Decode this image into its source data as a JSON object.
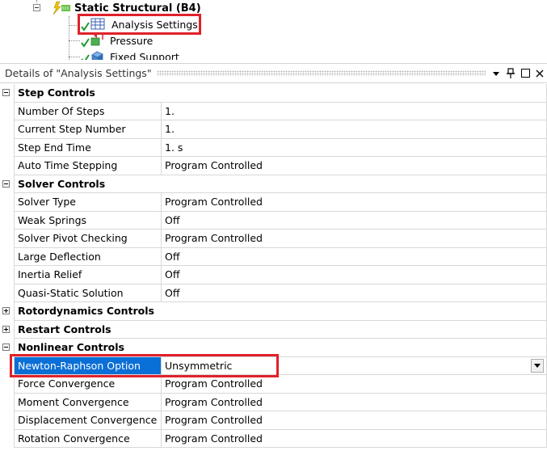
{
  "tree": {
    "root_label": "Static Structural (B4)",
    "items": [
      {
        "label": "Analysis Settings",
        "icon": "analysis-settings-icon"
      },
      {
        "label": "Pressure",
        "icon": "pressure-icon"
      },
      {
        "label": "Fixed Support",
        "icon": "fixed-support-icon"
      }
    ]
  },
  "details": {
    "title": "Details of \"Analysis Settings\"",
    "pin_glyph": "📌",
    "dropdown_glyph": "▾",
    "close_glyph": "✕"
  },
  "sections": [
    {
      "title": "Step Controls",
      "expanded": true,
      "rows": [
        {
          "name": "Number Of Steps",
          "value": "1."
        },
        {
          "name": "Current Step Number",
          "value": "1."
        },
        {
          "name": "Step End Time",
          "value": "1. s"
        },
        {
          "name": "Auto Time Stepping",
          "value": "Program Controlled"
        }
      ]
    },
    {
      "title": "Solver Controls",
      "expanded": true,
      "rows": [
        {
          "name": "Solver Type",
          "value": "Program Controlled"
        },
        {
          "name": "Weak Springs",
          "value": "Off"
        },
        {
          "name": "Solver Pivot Checking",
          "value": "Program Controlled"
        },
        {
          "name": "Large Deflection",
          "value": "Off"
        },
        {
          "name": "Inertia Relief",
          "value": "Off"
        },
        {
          "name": "Quasi-Static Solution",
          "value": "Off"
        }
      ]
    },
    {
      "title": "Rotordynamics Controls",
      "expanded": false,
      "rows": []
    },
    {
      "title": "Restart Controls",
      "expanded": false,
      "rows": []
    },
    {
      "title": "Nonlinear Controls",
      "expanded": true,
      "rows": [
        {
          "name": "Newton-Raphson Option",
          "value": "Unsymmetric",
          "selected": true
        },
        {
          "name": "Force Convergence",
          "value": "Program Controlled"
        },
        {
          "name": "Moment Convergence",
          "value": "Program Controlled"
        },
        {
          "name": "Displacement Convergence",
          "value": "Program Controlled"
        },
        {
          "name": "Rotation Convergence",
          "value": "Program Controlled"
        }
      ]
    }
  ],
  "colors": {
    "highlight": "#e0212b",
    "selection": "#0a6fd6"
  }
}
